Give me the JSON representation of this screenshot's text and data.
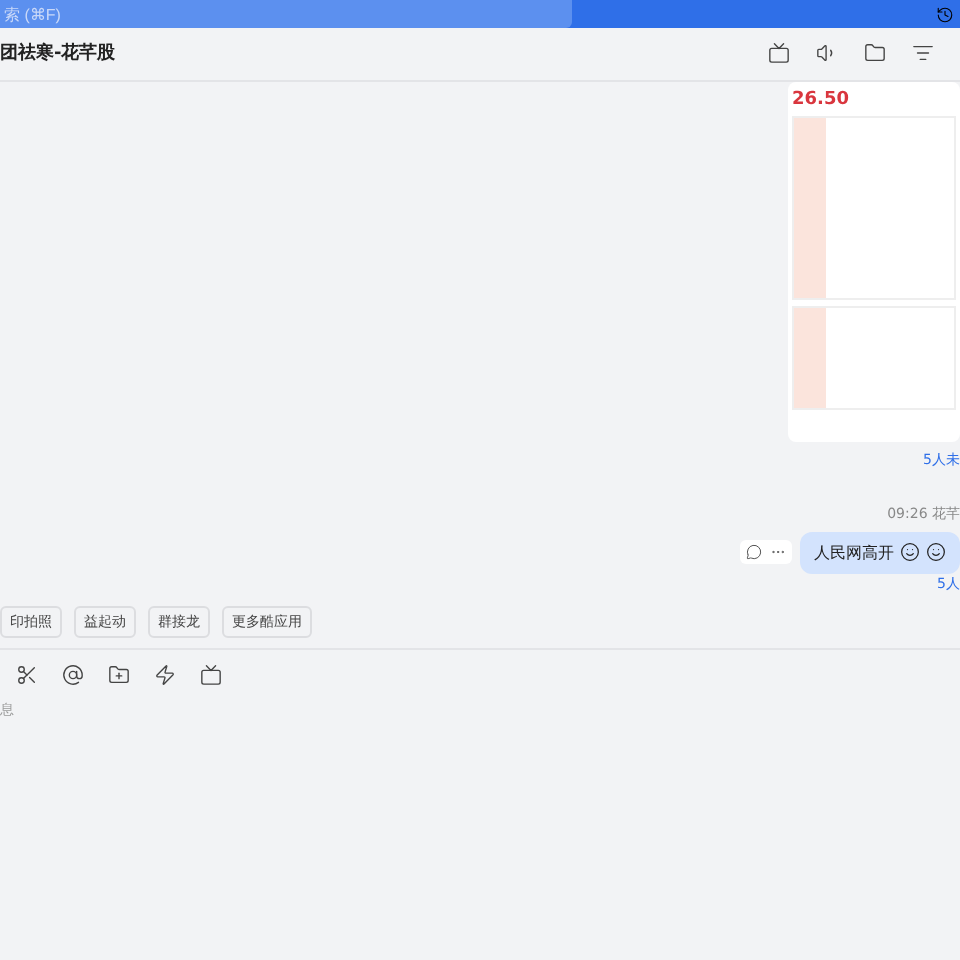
{
  "search": {
    "placeholder": "索 (⌘F)"
  },
  "header": {
    "title": "团祛寒-花芊股"
  },
  "messages": [
    {
      "kind": "image",
      "price": "26.50",
      "read_status": "5人未"
    },
    {
      "kind": "text",
      "meta": "09:26 花芊",
      "text": "人民网高开",
      "read_status": "5人"
    }
  ],
  "apps": [
    {
      "label": "印拍照"
    },
    {
      "label": "益起动"
    },
    {
      "label": "群接龙"
    },
    {
      "label": "更多酷应用"
    }
  ],
  "composer": {
    "placeholder": "息"
  }
}
